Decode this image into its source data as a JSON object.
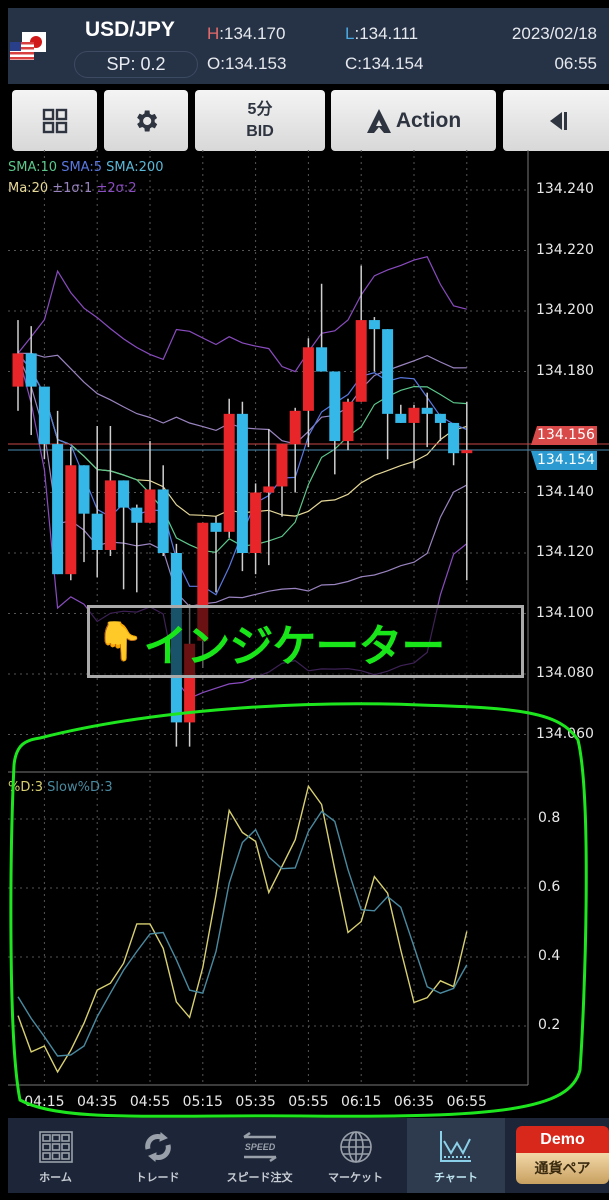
{
  "header": {
    "pair": "USD/JPY",
    "spread": "SP: 0.2",
    "high_label": "H",
    "high": ":134.170",
    "low_label": "L",
    "low": ":134.111",
    "open_label": "O",
    "open": ":134.153",
    "close_label": "C",
    "close": ":134.154",
    "date": "2023/02/18",
    "time": "06:55",
    "flag_icon": "usd-jpy-flag-icon"
  },
  "toolbar": {
    "layout_icon": "grid-icon",
    "settings_icon": "gear-icon",
    "timeframe": "5分",
    "price_type": "BID",
    "action_label": "Action",
    "collapse_icon": "collapse-left-icon"
  },
  "legend": {
    "sma10": "SMA:10",
    "sma5": "SMA:5",
    "sma200": "SMA:200",
    "ma20": "Ma:20",
    "sigma1": "±1σ:1",
    "sigma2": "±2σ:2",
    "stoch_d": "%D:3",
    "stoch_slow": "Slow%D:3"
  },
  "colors": {
    "up": "#e8262a",
    "down": "#35b8e8",
    "sma10": "#5cc88c",
    "sma5": "#5a78e0",
    "sma200": "#5ab8d8",
    "ma20": "#e6d898",
    "sigma1": "#9a84c0",
    "sigma2": "#8a4cc0",
    "stoch_d": "#d8d070",
    "stoch_slow": "#4a8aa0",
    "annotation": "#19e619",
    "bid_tag": "#d84a4a",
    "ask_tag": "#2a9ad0"
  },
  "price_axis": {
    "labels": [
      "134.240",
      "134.220",
      "134.200",
      "134.180",
      "134.140",
      "134.120",
      "134.100",
      "134.080",
      "134.060"
    ],
    "bid_tag": "134.156",
    "last_tag": "134.154"
  },
  "annotation": {
    "emoji": "👇",
    "text": "インジケーター"
  },
  "chart_data": [
    {
      "type": "candlestick",
      "ylim": [
        134.055,
        134.245
      ],
      "indicators": [
        "SMA 10",
        "SMA 5",
        "SMA 200",
        "MA 20",
        "Bollinger ±1σ",
        "Bollinger ±2σ"
      ],
      "grid": true,
      "candles": [
        [
          134.175,
          134.186,
          134.197,
          134.167
        ],
        [
          134.186,
          134.175,
          134.195,
          134.159
        ],
        [
          134.175,
          134.156,
          134.175,
          134.151
        ],
        [
          134.156,
          134.113,
          134.167,
          134.113
        ],
        [
          134.113,
          134.149,
          134.155,
          134.111
        ],
        [
          134.149,
          134.133,
          134.149,
          134.117
        ],
        [
          134.133,
          134.121,
          134.162,
          134.112
        ],
        [
          134.121,
          134.144,
          134.162,
          134.119
        ],
        [
          134.144,
          134.135,
          134.144,
          134.108
        ],
        [
          134.135,
          134.13,
          134.136,
          134.107
        ],
        [
          134.13,
          134.141,
          134.157,
          134.13
        ],
        [
          134.141,
          134.12,
          134.149,
          134.119
        ],
        [
          134.12,
          134.064,
          134.123,
          134.056
        ],
        [
          134.064,
          134.09,
          134.103,
          134.056
        ],
        [
          134.091,
          134.13,
          134.13,
          134.082
        ],
        [
          134.13,
          134.127,
          134.132,
          134.107
        ],
        [
          134.127,
          134.166,
          134.171,
          134.125
        ],
        [
          134.166,
          134.12,
          134.17,
          134.114
        ],
        [
          134.12,
          134.14,
          134.143,
          134.113
        ],
        [
          134.14,
          134.142,
          134.161,
          134.116
        ],
        [
          134.142,
          134.156,
          134.156,
          134.132
        ],
        [
          134.156,
          134.167,
          134.168,
          134.14
        ],
        [
          134.167,
          134.188,
          134.191,
          134.155
        ],
        [
          134.188,
          134.18,
          134.209,
          134.18
        ],
        [
          134.18,
          134.157,
          134.18,
          134.146
        ],
        [
          134.157,
          134.17,
          134.171,
          134.154
        ],
        [
          134.17,
          134.197,
          134.215,
          134.17
        ],
        [
          134.197,
          134.194,
          134.198,
          134.18
        ],
        [
          134.194,
          134.166,
          134.194,
          134.151
        ],
        [
          134.166,
          134.163,
          134.169,
          134.163
        ],
        [
          134.163,
          134.168,
          134.169,
          134.148
        ],
        [
          134.168,
          134.166,
          134.173,
          134.155
        ],
        [
          134.166,
          134.163,
          134.166,
          134.157
        ],
        [
          134.163,
          134.153,
          134.163,
          134.149
        ],
        [
          134.153,
          134.154,
          134.17,
          134.111
        ]
      ],
      "candle_fields": [
        "open",
        "close",
        "high",
        "low"
      ],
      "first_time": "04:05",
      "interval_min": 5
    },
    {
      "type": "line",
      "ylim": [
        0,
        1
      ],
      "yticks": [
        "0.8",
        "0.6",
        "0.4",
        "0.2"
      ],
      "xticks": [
        "04:15",
        "04:35",
        "04:55",
        "05:15",
        "05:35",
        "05:55",
        "06:15",
        "06:35",
        "06:55"
      ],
      "grid": true,
      "series": [
        {
          "name": "%D:3",
          "values": [
            0.23,
            0.125,
            0.142,
            0.067,
            0.13,
            0.208,
            0.304,
            0.324,
            0.382,
            0.496,
            0.496,
            0.425,
            0.27,
            0.225,
            0.37,
            0.58,
            0.825,
            0.761,
            0.735,
            0.587,
            0.663,
            0.74,
            0.895,
            0.842,
            0.653,
            0.471,
            0.503,
            0.633,
            0.585,
            0.42,
            0.268,
            0.282,
            0.331,
            0.314,
            0.474
          ]
        },
        {
          "name": "Slow%D:3",
          "values": [
            0.285,
            0.222,
            0.169,
            0.113,
            0.116,
            0.142,
            0.227,
            0.295,
            0.362,
            0.416,
            0.467,
            0.471,
            0.392,
            0.304,
            0.295,
            0.416,
            0.614,
            0.732,
            0.769,
            0.69,
            0.656,
            0.658,
            0.764,
            0.822,
            0.793,
            0.653,
            0.537,
            0.534,
            0.575,
            0.544,
            0.43,
            0.314,
            0.295,
            0.309,
            0.377
          ]
        }
      ]
    }
  ],
  "nav": {
    "items": [
      {
        "label": "ホーム",
        "icon": "home-grid-icon"
      },
      {
        "label": "トレード",
        "icon": "refresh-icon"
      },
      {
        "label": "スピード注文",
        "icon": "speed-order-icon"
      },
      {
        "label": "マーケット",
        "icon": "globe-icon"
      },
      {
        "label": "チャート",
        "icon": "chart-icon"
      }
    ],
    "demo": "Demo",
    "pair_select": "通貨ペア"
  }
}
